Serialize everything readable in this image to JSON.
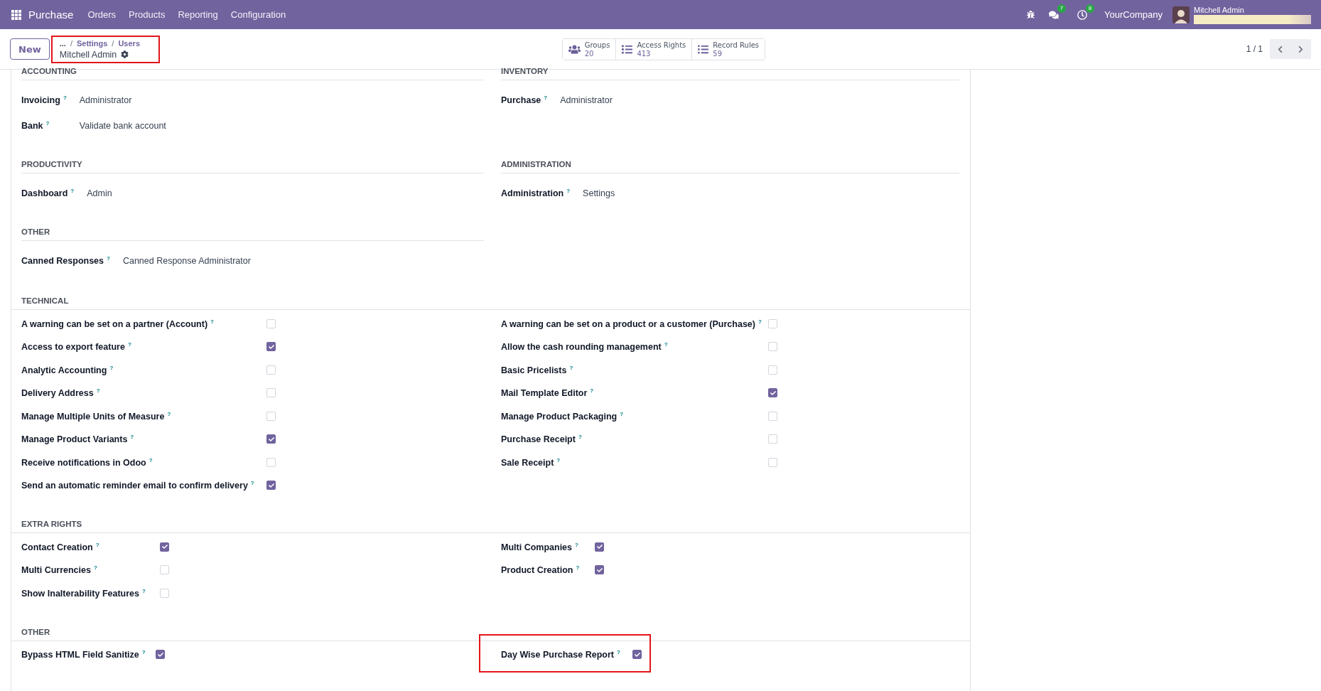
{
  "top_bar": {
    "app_name": "Purchase",
    "menu": [
      "Orders",
      "Products",
      "Reporting",
      "Configuration"
    ],
    "message_count": "7",
    "activity_count": "8",
    "company": "YourCompany",
    "user": "Mitchell Admin"
  },
  "control_panel": {
    "new_button": "New",
    "breadcrumb": {
      "highlighted": true,
      "ellipsis": "...",
      "links": [
        "Settings",
        "Users"
      ],
      "separator": "/",
      "record": "Mitchell Admin"
    },
    "stat_buttons": [
      {
        "kind": "users",
        "label": "Groups",
        "value": "20"
      },
      {
        "kind": "list",
        "label": "Access Rights",
        "value": "413"
      },
      {
        "kind": "bullets",
        "label": "Record Rules",
        "value": "59"
      }
    ],
    "pager": "1 / 1"
  },
  "field_rows": [
    {
      "sections": [
        {
          "title": "ACCOUNTING",
          "fields": [
            {
              "label": "Invoicing",
              "help": "?",
              "value": "Administrator"
            },
            {
              "label": "Bank",
              "help": "?",
              "value": "Validate bank account"
            }
          ]
        },
        {
          "title": "INVENTORY",
          "fields": [
            {
              "label": "Purchase",
              "help": "?",
              "value": "Administrator"
            }
          ]
        }
      ]
    },
    {
      "sections": [
        {
          "title": "PRODUCTIVITY",
          "fields": [
            {
              "label": "Dashboard",
              "help": "?",
              "value": "Admin"
            }
          ]
        },
        {
          "title": "ADMINISTRATION",
          "fields": [
            {
              "label": "Administration",
              "help": "?",
              "value": "Settings"
            }
          ]
        }
      ]
    },
    {
      "sections": [
        {
          "title": "OTHER",
          "fields": [
            {
              "label": "Canned Responses",
              "help": "?",
              "value": "Canned Response Administrator"
            }
          ]
        }
      ]
    }
  ],
  "checkbox_sections": [
    {
      "title": "TECHNICAL",
      "left_items": [
        {
          "label": "A warning can be set on a partner (Account)",
          "help": "?",
          "checked": false,
          "highlighted": false
        },
        {
          "label": "Access to export feature",
          "help": "?",
          "checked": true,
          "highlighted": false
        },
        {
          "label": "Analytic Accounting",
          "help": "?",
          "checked": false,
          "highlighted": false
        },
        {
          "label": "Delivery Address",
          "help": "?",
          "checked": false,
          "highlighted": false
        },
        {
          "label": "Manage Multiple Units of Measure",
          "help": "?",
          "checked": false,
          "highlighted": false
        },
        {
          "label": "Manage Product Variants",
          "help": "?",
          "checked": true,
          "highlighted": false
        },
        {
          "label": "Receive notifications in Odoo",
          "help": "?",
          "checked": false,
          "highlighted": false
        },
        {
          "label": "Send an automatic reminder email to confirm delivery",
          "help": "?",
          "checked": true,
          "highlighted": false
        }
      ],
      "right_items": [
        {
          "label": "A warning can be set on a product or a customer (Purchase)",
          "help": "?",
          "checked": false,
          "highlighted": false
        },
        {
          "label": "Allow the cash rounding management",
          "help": "?",
          "checked": false,
          "highlighted": false
        },
        {
          "label": "Basic Pricelists",
          "help": "?",
          "checked": false,
          "highlighted": false
        },
        {
          "label": "Mail Template Editor",
          "help": "?",
          "checked": true,
          "highlighted": false
        },
        {
          "label": "Manage Product Packaging",
          "help": "?",
          "checked": false,
          "highlighted": false
        },
        {
          "label": "Purchase Receipt",
          "help": "?",
          "checked": false,
          "highlighted": false
        },
        {
          "label": "Sale Receipt",
          "help": "?",
          "checked": false,
          "highlighted": false
        }
      ]
    },
    {
      "title": "EXTRA RIGHTS",
      "left_items": [
        {
          "label": "Contact Creation",
          "help": "?",
          "checked": true,
          "highlighted": false
        },
        {
          "label": "Multi Currencies",
          "help": "?",
          "checked": false,
          "highlighted": false
        },
        {
          "label": "Show Inalterability Features",
          "help": "?",
          "checked": false,
          "highlighted": false
        }
      ],
      "right_items": [
        {
          "label": "Multi Companies",
          "help": "?",
          "checked": true,
          "highlighted": false
        },
        {
          "label": "Product Creation",
          "help": "?",
          "checked": true,
          "highlighted": false
        }
      ]
    },
    {
      "title": "OTHER",
      "left_items": [
        {
          "label": "Bypass HTML Field Sanitize",
          "help": "?",
          "checked": true,
          "highlighted": false
        }
      ],
      "right_items": [
        {
          "label": "Day Wise Purchase Report",
          "help": "?",
          "checked": true,
          "highlighted": true
        }
      ]
    }
  ]
}
